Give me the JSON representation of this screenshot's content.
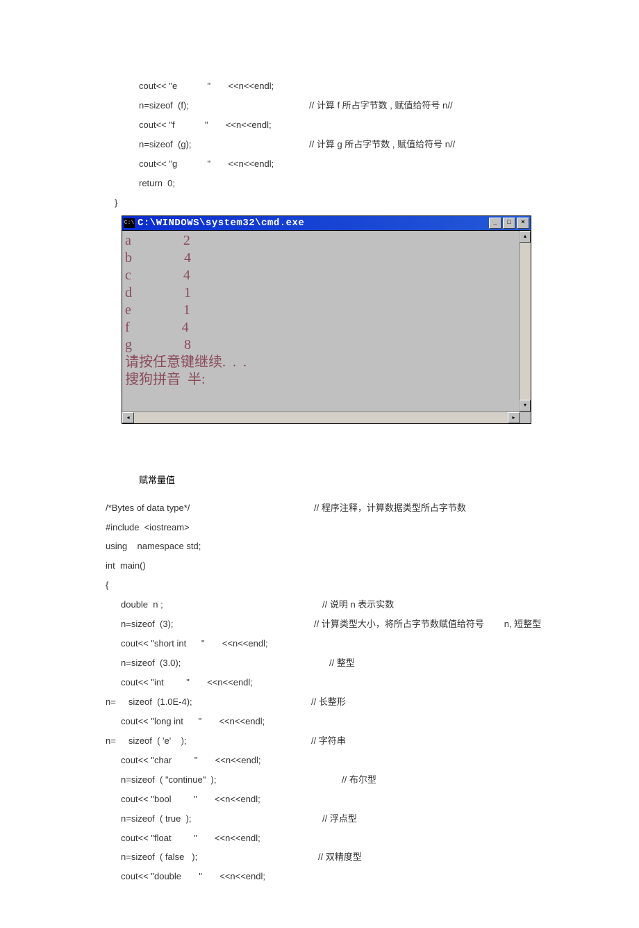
{
  "code_top": {
    "l1": "cout<< \"e            \"       <<n<<endl;",
    "l2a": "n=sizeof  (f);",
    "l2b": "// 计算 f 所占字节数 , 赋值给符号 n//",
    "l3": "cout<< \"f            \"       <<n<<endl;",
    "l4a": "n=sizeof  (g);",
    "l4b": "// 计算 g 所占字节数 , 赋值给符号 n//",
    "l5": "cout<< \"g            \"       <<n<<endl;",
    "l6": "return  0;",
    "l7": "}"
  },
  "console": {
    "title_icon": "C:\\",
    "title": "C:\\WINDOWS\\system32\\cmd.exe",
    "btn_min": "_",
    "btn_max": "□",
    "btn_close": "×",
    "rows": [
      "a               2",
      "b               4",
      "c               4",
      "d               1",
      "e               1",
      "f               4",
      "g               8",
      "请按任意键继续.  .  .",
      "",
      "",
      "搜狗拼音  半:"
    ],
    "scroll_up": "▴",
    "scroll_down": "▾",
    "scroll_left": "◂",
    "scroll_right": "▸"
  },
  "section_title": "赋常量值",
  "code_bottom": {
    "l1a": "/*Bytes of data type*/",
    "l1b": "// 程序注释，计算数据类型所占字节数",
    "l2": "#include  <iostream>",
    "l3": "using    namespace std;",
    "l4": "int  main()",
    "l5": "{",
    "l6a": "double  n ;",
    "l6b": "// 说明 n 表示实数",
    "l7a": "n=sizeof  (3);",
    "l7b": "// 计算类型大小，将所占字节数赋值给符号        n, 短整型",
    "l8": "cout<< \"short int      \"       <<n<<endl;",
    "l9a": "n=sizeof  (3.0);",
    "l9b": "// 整型",
    "l10": "cout<< \"int         \"       <<n<<endl;",
    "l11a": "n=     sizeof  (1.0E-4);",
    "l11b": "// 长整形",
    "l12": "cout<< \"long int      \"       <<n<<endl;",
    "l13a": "n=     sizeof  ( 'e'    );",
    "l13b": "// 字符串",
    "l14": "cout<< \"char         \"       <<n<<endl;",
    "l15a": "n=sizeof  ( \"continue\"  );",
    "l15b": "// 布尔型",
    "l16": "cout<< \"bool         \"       <<n<<endl;",
    "l17a": "n=sizeof  ( true  );",
    "l17b": "// 浮点型",
    "l18": "cout<< \"float         \"       <<n<<endl;",
    "l19a": "n=sizeof  ( false   );",
    "l19b": "// 双精度型",
    "l20": "cout<< \"double       \"       <<n<<endl;"
  }
}
